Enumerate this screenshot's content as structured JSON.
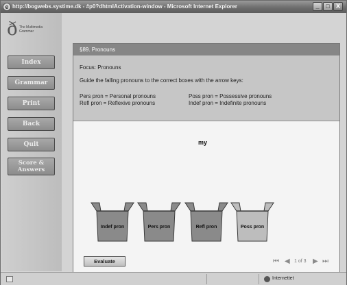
{
  "window": {
    "title": "http://bogwebs.systime.dk - #p0?dhtmlActivation-window - Microsoft Internet Explorer",
    "minimize": "_",
    "maximize": "□",
    "close": "X"
  },
  "logo": {
    "mark": "ð",
    "text": "The Multimedia Grammar"
  },
  "nav": [
    "Index",
    "Grammar",
    "Print",
    "Back",
    "Quit",
    "Score &\nAnswers"
  ],
  "exercise": {
    "header": "§89. Pronouns",
    "focus": "Focus: Pronouns",
    "instruction": "Guide the falling pronouns to the correct boxes with the arrow keys:",
    "legend": {
      "pers": "Pers pron = Personal pronouns",
      "poss": "Poss pron = Possessive pronouns",
      "refl": "Refl pron = Reflexive pronouns",
      "indef": "Indef pron = Indefinite pronouns"
    },
    "falling_word": "my",
    "boxes": [
      {
        "label": "Indef pron",
        "color": "#8a8a8a"
      },
      {
        "label": "Pers pron",
        "color": "#8a8a8a"
      },
      {
        "label": "Refl pron",
        "color": "#8a8a8a"
      },
      {
        "label": "Poss pron",
        "color": "#bdbdbd"
      }
    ],
    "evaluate_label": "Evaluate",
    "pager": {
      "first": "⏮",
      "prev": "◀",
      "page_text": "1 of 3",
      "next": "▶",
      "last": "⏭"
    }
  },
  "status": {
    "zone": "Internettet"
  }
}
